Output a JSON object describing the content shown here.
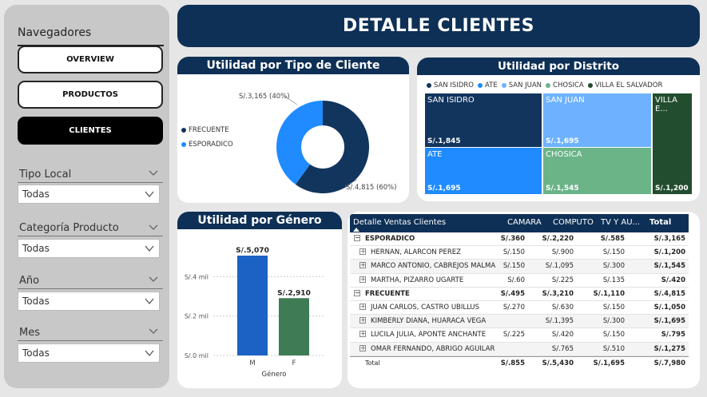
{
  "header": {
    "title": "DETALLE CLIENTES"
  },
  "sidebar": {
    "nav_title": "Navegadores",
    "buttons": [
      {
        "label": "OVERVIEW"
      },
      {
        "label": "PRODUCTOS"
      },
      {
        "label": "CLIENTES",
        "active": true
      }
    ],
    "filters": [
      {
        "label": "Tipo Local",
        "value": "Todas"
      },
      {
        "label": "Categoría Producto",
        "value": "Todas"
      },
      {
        "label": "Año",
        "value": "Todas"
      },
      {
        "label": "Mes",
        "value": "Todas"
      }
    ]
  },
  "donut": {
    "title": "Utilidad por Tipo de Cliente",
    "legend": [
      "FRECUENTE",
      "ESPORADICO"
    ],
    "colors": {
      "FRECUENTE": "#12355e",
      "ESPORADICO": "#1f8bff"
    },
    "label_top": "S/.3,165 (40%)",
    "label_bottom": "S/.4,815 (60%)"
  },
  "treemap": {
    "title": "Utilidad por Distrito",
    "legend": [
      "SAN ISIDRO",
      "ATE",
      "SAN JUAN",
      "CHOSICA",
      "VILLA EL SALVADOR"
    ],
    "tiles": [
      {
        "name": "SAN ISIDRO",
        "value": "S/.1,845",
        "color": "#12355e"
      },
      {
        "name": "SAN JUAN",
        "value": "S/.1,695",
        "color": "#6eb2ff"
      },
      {
        "name": "VILLA E...",
        "value": "S/.1,200",
        "color": "#224d2e"
      },
      {
        "name": "ATE",
        "value": "S/.1,695",
        "color": "#1f8bff"
      },
      {
        "name": "CHOSICA",
        "value": "S/.1,545",
        "color": "#6ab488"
      }
    ]
  },
  "gender": {
    "title": "Utilidad por Género"
  },
  "chart_data": {
    "type": "bar",
    "title": "Utilidad por Género",
    "categories": [
      "M",
      "F"
    ],
    "values": [
      5070,
      2910
    ],
    "data_labels": [
      "S/.5,070",
      "S/.2,910"
    ],
    "colors": [
      "#1b62c4",
      "#3f7b55"
    ],
    "xlabel": "Género",
    "ylabel": "",
    "yticks": [
      "S/.0 mil",
      "S/.2 mil",
      "S/.4 mil"
    ],
    "ytick_values": [
      0,
      2000,
      4000
    ],
    "ylim": [
      0,
      5070
    ]
  },
  "table": {
    "headers": [
      "Detalle Ventas Clientes",
      "CAMARA",
      "COMPUTO",
      "TV Y AU...",
      "Total"
    ],
    "rows": [
      {
        "group": true,
        "cells": [
          "ESPORADICO",
          "S/.360",
          "S/.2,220",
          "S/.585",
          "S/.3,165"
        ]
      },
      {
        "cells": [
          "HERNAN, ALARCON PEREZ",
          "S/.150",
          "S/.900",
          "S/.150",
          "S/.1,200"
        ]
      },
      {
        "cells": [
          "MARCO ANTONIO, CABREJOS MALMA",
          "S/.150",
          "S/.1,095",
          "S/.300",
          "S/.1,545"
        ]
      },
      {
        "cells": [
          "MARTHA, PIZARRO UGARTE",
          "S/.60",
          "S/.225",
          "S/.135",
          "S/.420"
        ]
      },
      {
        "group": true,
        "cells": [
          "FRECUENTE",
          "S/.495",
          "S/.3,210",
          "S/.1,110",
          "S/.4,815"
        ]
      },
      {
        "cells": [
          "JUAN CARLOS, CASTRO UBILLUS",
          "S/.270",
          "S/.630",
          "S/.150",
          "S/.1,050"
        ]
      },
      {
        "cells": [
          "KIMBERLY DIANA, HUARACA VEGA",
          "",
          "S/.1,395",
          "S/.300",
          "S/.1,695"
        ]
      },
      {
        "cells": [
          "LUCILA JULIA, APONTE ANCHANTE",
          "S/.225",
          "S/.420",
          "S/.150",
          "S/.795"
        ]
      },
      {
        "cells": [
          "OMAR FERNANDO, ABRIGO AGUILAR",
          "",
          "S/.765",
          "S/.510",
          "S/.1,275"
        ]
      }
    ],
    "total": [
      "Total",
      "S/.855",
      "S/.5,430",
      "S/.1,695",
      "S/.7,980"
    ]
  }
}
